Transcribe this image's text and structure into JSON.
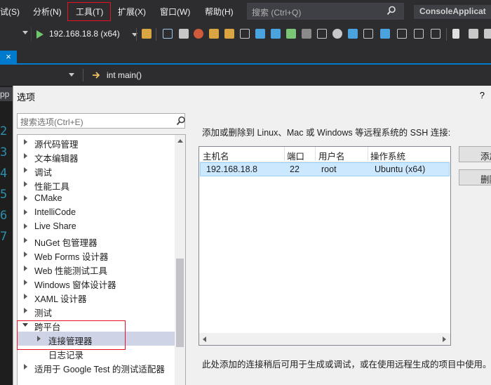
{
  "menubar": {
    "items": [
      "试(S)",
      "分析(N)",
      "工具(T)",
      "扩展(X)",
      "窗口(W)",
      "帮助(H)"
    ],
    "search_placeholder": "搜索 (Ctrl+Q)",
    "app_title": "ConsoleApplicat"
  },
  "toolbar": {
    "run_target": "192.168.18.8 (x64)"
  },
  "doc_tab": {
    "close_glyph": "×"
  },
  "navbar": {
    "function": "int main()"
  },
  "editor": {
    "solution_fragment": "pp",
    "line_numbers": [
      "2",
      "3",
      "4",
      "5",
      "6",
      "7"
    ]
  },
  "dialog": {
    "title": "选项",
    "help": "?",
    "search_placeholder": "搜索选项(Ctrl+E)",
    "tree": [
      "源代码管理",
      "文本编辑器",
      "调试",
      "性能工具",
      "CMake",
      "IntelliCode",
      "Live Share",
      "NuGet 包管理器",
      "Web Forms 设计器",
      "Web 性能测试工具",
      "Windows 窗体设计器",
      "XAML 设计器",
      "测试",
      "跨平台",
      "连接管理器",
      "日志记录",
      "适用于 Google Test 的测试适配器"
    ],
    "ssh_heading": "添加或删除到 Linux、Mac 或 Windows 等远程系统的 SSH 连接:",
    "columns": [
      "主机名",
      "端口",
      "用户名",
      "操作系统"
    ],
    "connections": [
      {
        "host": "192.168.18.8",
        "port": "22",
        "user": "root",
        "os": "Ubuntu (x64)"
      }
    ],
    "add_button": "添加",
    "remove_button": "删除",
    "footnote": "此处添加的连接稍后可用于生成或调试，或在使用远程生成的项目中使用。"
  },
  "colors": {
    "accent": "#007acc",
    "highlight_box": "#e81123",
    "selected_row": "#cce8ff",
    "tree_selected": "#cfd3e6"
  }
}
